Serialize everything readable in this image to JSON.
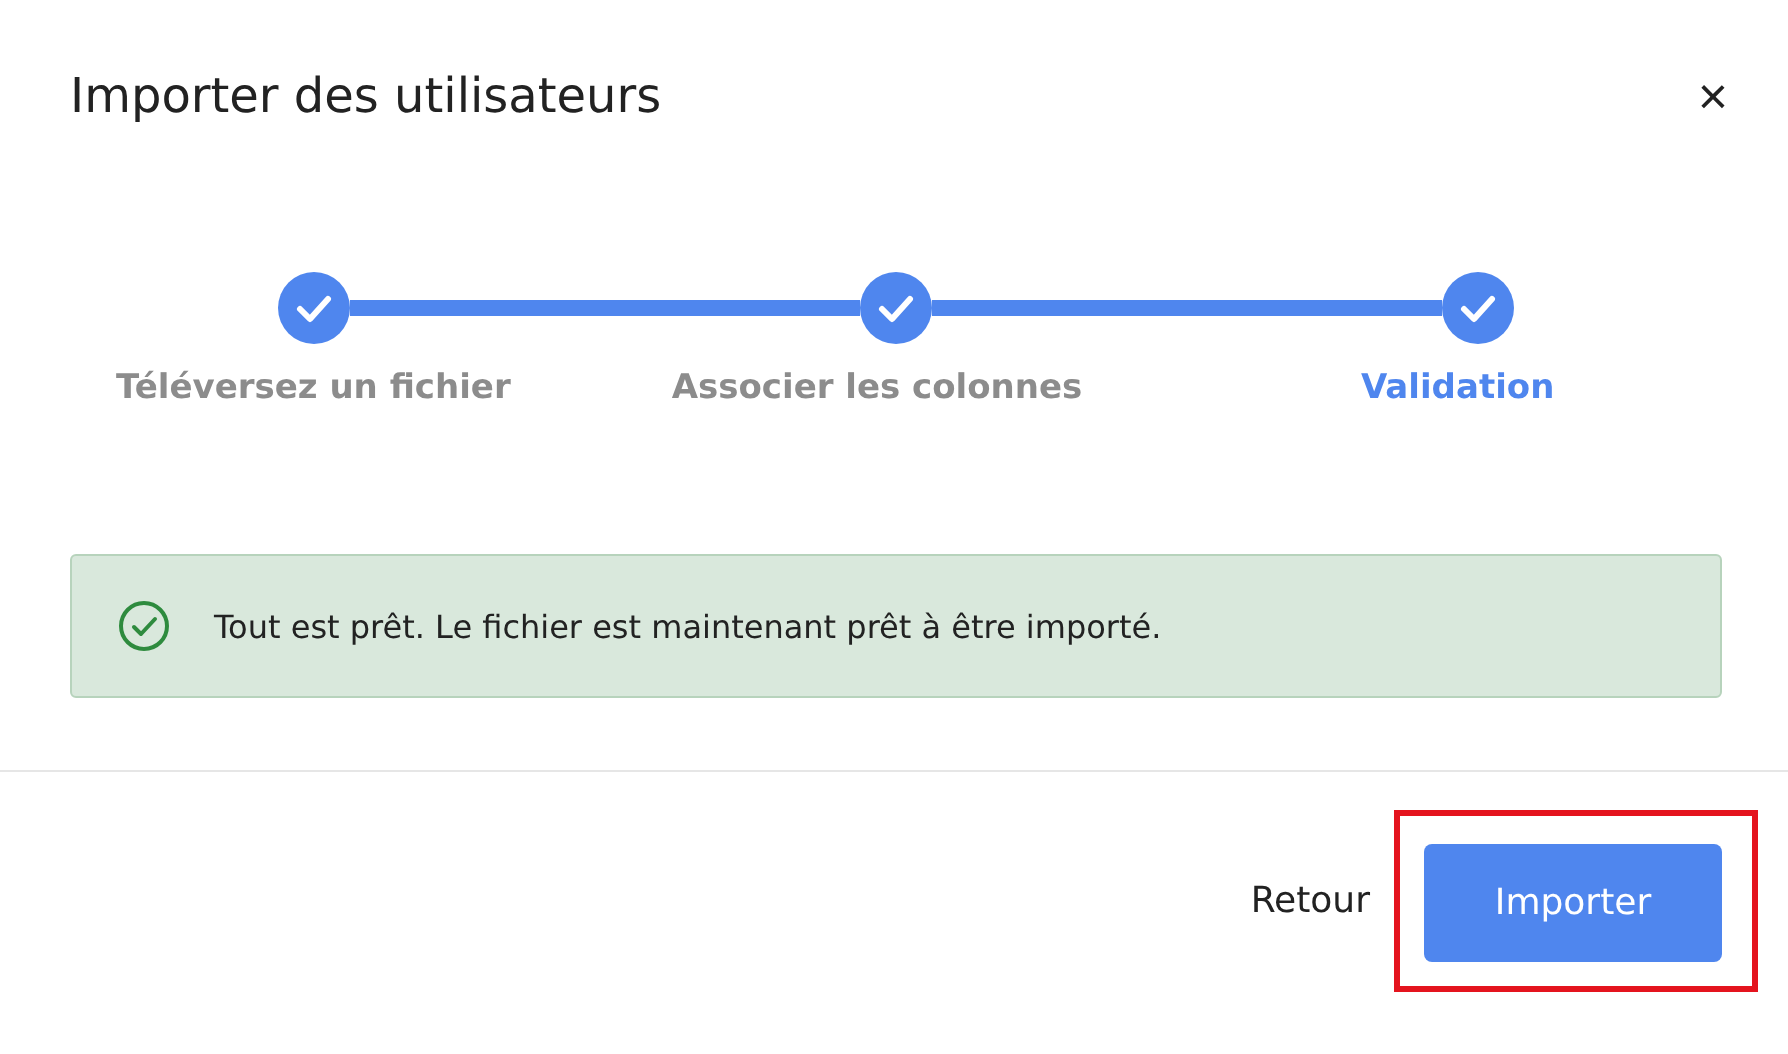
{
  "dialog": {
    "title": "Importer des utilisateurs",
    "close": "×"
  },
  "steps": [
    {
      "label": "Téléversez un fichier",
      "completed": true,
      "selected": false
    },
    {
      "label": "Associer les colonnes",
      "completed": true,
      "selected": false
    },
    {
      "label": "Validation",
      "completed": true,
      "selected": true
    }
  ],
  "alert": {
    "kind": "success",
    "message": "Tout est prêt. Le fichier est maintenant prêt à être importé."
  },
  "footer": {
    "buttons": [
      {
        "label": "Retour",
        "kind": "text",
        "highlighted": false
      },
      {
        "label": "Importer",
        "kind": "primary",
        "highlighted": true
      }
    ]
  }
}
